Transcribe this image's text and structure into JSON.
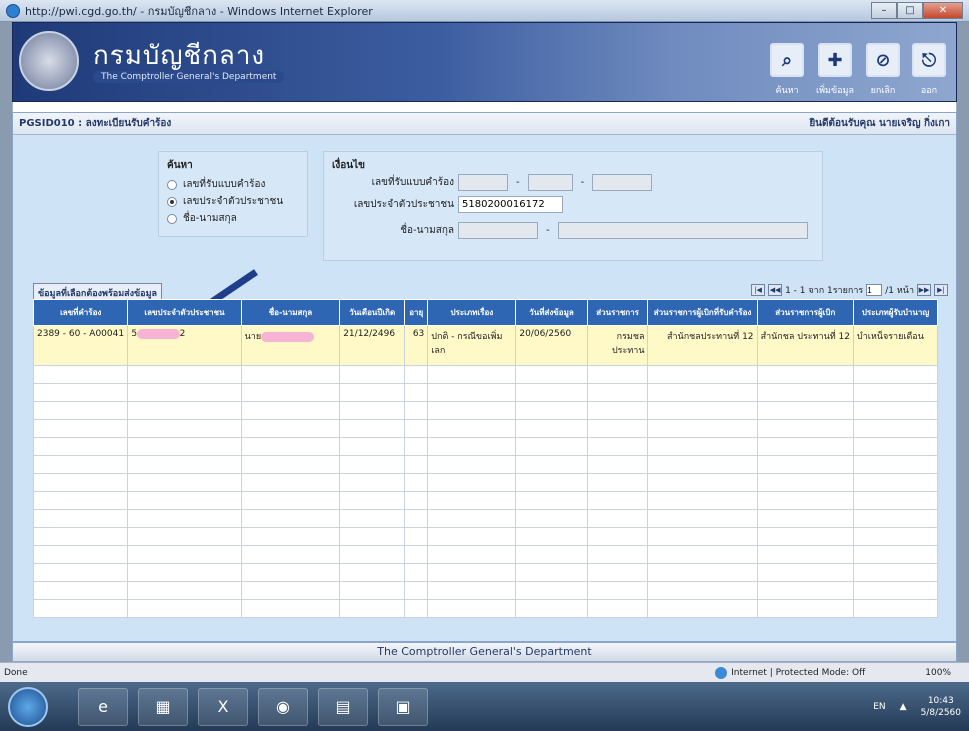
{
  "browser": {
    "title": "http://pwi.cgd.go.th/ - กรมบัญชีกลาง - Windows Internet Explorer",
    "status_left": "Done",
    "status_zone": "Internet | Protected Mode: Off",
    "zoom": "100%"
  },
  "header": {
    "brand": "กรมบัญชีกลาง",
    "brand_sub": "The Comptroller General's Department",
    "buttons": [
      {
        "label": "ค้นหา",
        "icon": "search-icon"
      },
      {
        "label": "เพิ่มข้อมูล",
        "icon": "add-icon"
      },
      {
        "label": "ยกเลิก",
        "icon": "cancel-icon"
      },
      {
        "label": "ออก",
        "icon": "exit-icon"
      }
    ]
  },
  "page": {
    "title": "PGSID010 : ลงทะเบียนรับคำร้อง",
    "welcome": "ยินดีต้อนรับคุณ นายเจริญ กิ่งเกา"
  },
  "search": {
    "legend": "ค้นหา",
    "options": [
      {
        "label": "เลขที่รับแบบคำร้อง",
        "selected": false
      },
      {
        "label": "เลขประจำตัวประชาชน",
        "selected": true
      },
      {
        "label": "ชื่อ-นามสกุล",
        "selected": false
      }
    ]
  },
  "conditions": {
    "legend": "เงื่อนไข",
    "request_no_label": "เลขที่รับแบบคำร้อง",
    "citizen_id_label": "เลขประจำตัวประชาชน",
    "citizen_id_value": "5180200016172",
    "name_label": "ชื่อ-นามสกุล"
  },
  "results": {
    "label": "ข้อมูลที่เลือกต้องพร้อมส่งข้อมูล",
    "pager_text": "1 - 1 จาก 1รายการ",
    "page_value": "1",
    "page_total": "/1 หน้า",
    "columns": [
      "เลขที่คำร้อง",
      "เลขประจำตัวประชาชน",
      "ชื่อ-นามสกุล",
      "วันเดือนปีเกิด",
      "อายุ",
      "ประเภทเรื่อง",
      "วันที่ส่งข้อมูล",
      "ส่วนราชการ",
      "ส่วนราชการผู้เบิกที่รับคำร้อง",
      "ส่วนราชการผู้เบิก",
      "ประเภทผู้รับบำนาญ"
    ],
    "rows": [
      {
        "request_no": "2389 - 60 - A00041",
        "citizen_id_start": "5",
        "citizen_id_end": "2",
        "name_prefix": "นาย",
        "dob": "21/12/2496",
        "age": "63",
        "type": "ปกติ - กรณีขอเพิ่มเลก",
        "send_date": "20/06/2560",
        "agency": "กรมชล ประทาน",
        "receiving_agency": "สำนักชลประทานที่ 12",
        "paying_agency": "สำนักชล ประทานที่ 12",
        "pension_type": "บำเหน็จรายเดือน"
      }
    ],
    "empty_rows": 14
  },
  "footer": {
    "text": "The Comptroller General's Department"
  },
  "taskbar": {
    "time": "10:43",
    "date": "5/8/2560",
    "lang": "EN"
  }
}
